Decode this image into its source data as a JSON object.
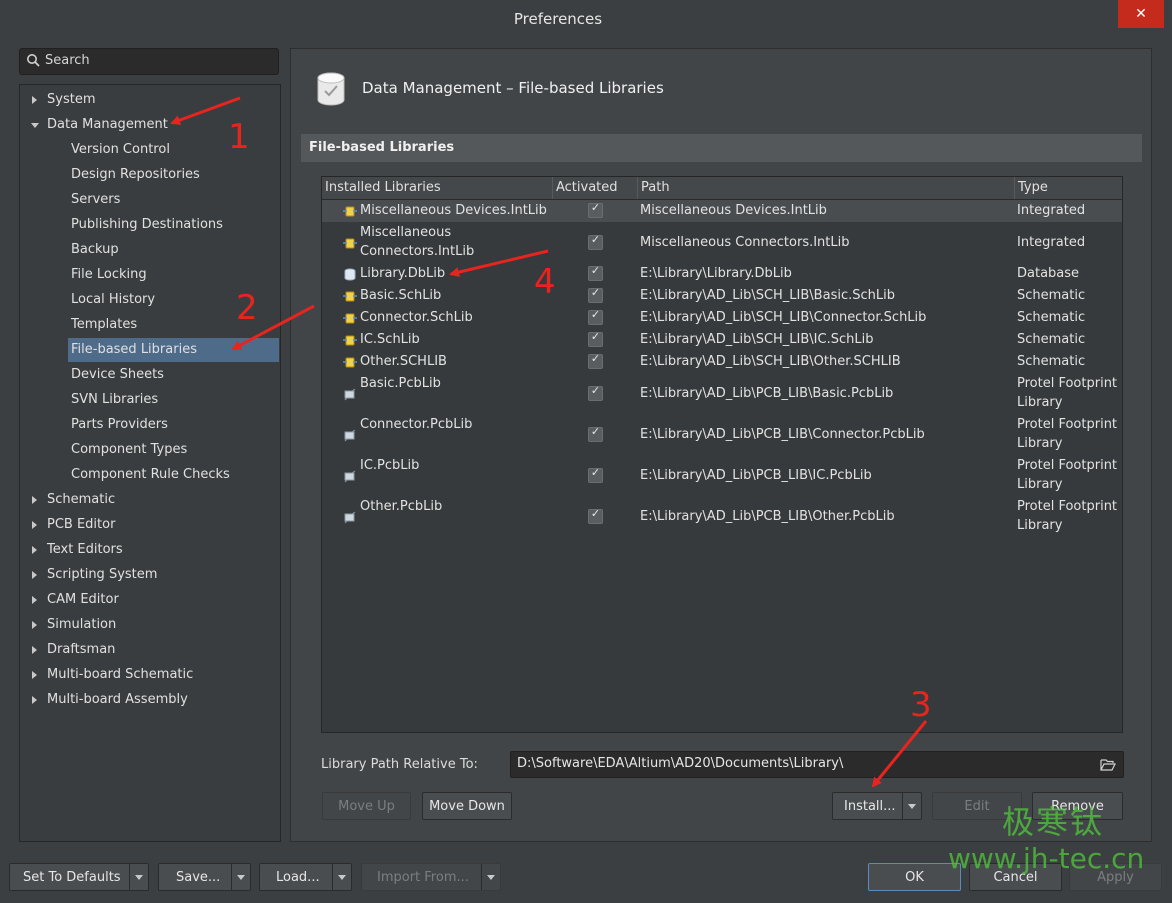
{
  "window": {
    "title": "Preferences",
    "close_glyph": "✕"
  },
  "search": {
    "placeholder": "Search"
  },
  "tree": [
    {
      "label": "System",
      "level": 0,
      "expander": "right"
    },
    {
      "label": "Data Management",
      "level": 0,
      "expander": "down"
    },
    {
      "label": "Version Control",
      "level": 1
    },
    {
      "label": "Design Repositories",
      "level": 1
    },
    {
      "label": "Servers",
      "level": 1
    },
    {
      "label": "Publishing Destinations",
      "level": 1
    },
    {
      "label": "Backup",
      "level": 1
    },
    {
      "label": "File Locking",
      "level": 1
    },
    {
      "label": "Local History",
      "level": 1
    },
    {
      "label": "Templates",
      "level": 1
    },
    {
      "label": "File-based Libraries",
      "level": 1,
      "selected": true
    },
    {
      "label": "Device Sheets",
      "level": 1
    },
    {
      "label": "SVN Libraries",
      "level": 1
    },
    {
      "label": "Parts Providers",
      "level": 1
    },
    {
      "label": "Component Types",
      "level": 1
    },
    {
      "label": "Component Rule Checks",
      "level": 1
    },
    {
      "label": "Schematic",
      "level": 0,
      "expander": "right"
    },
    {
      "label": "PCB Editor",
      "level": 0,
      "expander": "right"
    },
    {
      "label": "Text Editors",
      "level": 0,
      "expander": "right"
    },
    {
      "label": "Scripting System",
      "level": 0,
      "expander": "right"
    },
    {
      "label": "CAM Editor",
      "level": 0,
      "expander": "right"
    },
    {
      "label": "Simulation",
      "level": 0,
      "expander": "right"
    },
    {
      "label": "Draftsman",
      "level": 0,
      "expander": "right"
    },
    {
      "label": "Multi-board Schematic",
      "level": 0,
      "expander": "right"
    },
    {
      "label": "Multi-board Assembly",
      "level": 0,
      "expander": "right"
    }
  ],
  "header": {
    "title": "Data Management – File-based Libraries",
    "icon": "database-check-icon"
  },
  "section": {
    "title": "File-based Libraries"
  },
  "grid": {
    "columns": [
      "Installed Libraries",
      "Activated",
      "Path",
      "Type"
    ],
    "rows": [
      {
        "name": [
          "Miscellaneous Devices.IntLib"
        ],
        "activated": true,
        "path": "Miscellaneous Devices.IntLib",
        "type": [
          "Integrated"
        ],
        "icon": "integrated-lib-icon",
        "selected": true
      },
      {
        "name": [
          "Miscellaneous",
          "Connectors.IntLib"
        ],
        "activated": true,
        "path": "Miscellaneous Connectors.IntLib",
        "type": [
          "Integrated"
        ],
        "icon": "integrated-lib-icon"
      },
      {
        "name": [
          "Library.DbLib"
        ],
        "activated": true,
        "path": "E:\\Library\\Library.DbLib",
        "type": [
          "Database"
        ],
        "icon": "database-lib-icon"
      },
      {
        "name": [
          "Basic.SchLib"
        ],
        "activated": true,
        "path": "E:\\Library\\AD_Lib\\SCH_LIB\\Basic.SchLib",
        "type": [
          "Schematic"
        ],
        "icon": "schematic-lib-icon"
      },
      {
        "name": [
          "Connector.SchLib"
        ],
        "activated": true,
        "path": "E:\\Library\\AD_Lib\\SCH_LIB\\Connector.SchLib",
        "type": [
          "Schematic"
        ],
        "icon": "schematic-lib-icon"
      },
      {
        "name": [
          "IC.SchLib"
        ],
        "activated": true,
        "path": "E:\\Library\\AD_Lib\\SCH_LIB\\IC.SchLib",
        "type": [
          "Schematic"
        ],
        "icon": "schematic-lib-icon"
      },
      {
        "name": [
          "Other.SCHLIB"
        ],
        "activated": true,
        "path": "E:\\Library\\AD_Lib\\SCH_LIB\\Other.SCHLIB",
        "type": [
          "Schematic"
        ],
        "icon": "schematic-lib-icon"
      },
      {
        "name": [
          "Basic.PcbLib"
        ],
        "activated": true,
        "path": "E:\\Library\\AD_Lib\\PCB_LIB\\Basic.PcbLib",
        "type": [
          "Protel Footprint",
          "Library"
        ],
        "icon": "pcb-lib-icon"
      },
      {
        "name": [
          "Connector.PcbLib"
        ],
        "activated": true,
        "path": "E:\\Library\\AD_Lib\\PCB_LIB\\Connector.PcbLib",
        "type": [
          "Protel Footprint",
          "Library"
        ],
        "icon": "pcb-lib-icon"
      },
      {
        "name": [
          "IC.PcbLib"
        ],
        "activated": true,
        "path": "E:\\Library\\AD_Lib\\PCB_LIB\\IC.PcbLib",
        "type": [
          "Protel Footprint",
          "Library"
        ],
        "icon": "pcb-lib-icon"
      },
      {
        "name": [
          "Other.PcbLib"
        ],
        "activated": true,
        "path": "E:\\Library\\AD_Lib\\PCB_LIB\\Other.PcbLib",
        "type": [
          "Protel Footprint",
          "Library"
        ],
        "icon": "pcb-lib-icon"
      }
    ]
  },
  "path_relative": {
    "label": "Library Path Relative To:",
    "value": "D:\\Software\\EDA\\Altium\\AD20\\Documents\\Library\\"
  },
  "buttons": {
    "move_up": "Move Up",
    "move_down": "Move Down",
    "install": "Install...",
    "edit": "Edit",
    "remove": "Remove",
    "set_defaults": "Set To Defaults",
    "save": "Save...",
    "load": "Load...",
    "import_from": "Import From...",
    "ok": "OK",
    "cancel": "Cancel",
    "apply": "Apply"
  },
  "annotations": [
    "1",
    "2",
    "3",
    "4"
  ],
  "watermark": {
    "chinese": "极寒钛",
    "url": "www.jh-tec.cn"
  },
  "colors": {
    "annotation": "#e8241e",
    "selection": "#4f6b8a",
    "watermark": "#50c83c"
  }
}
